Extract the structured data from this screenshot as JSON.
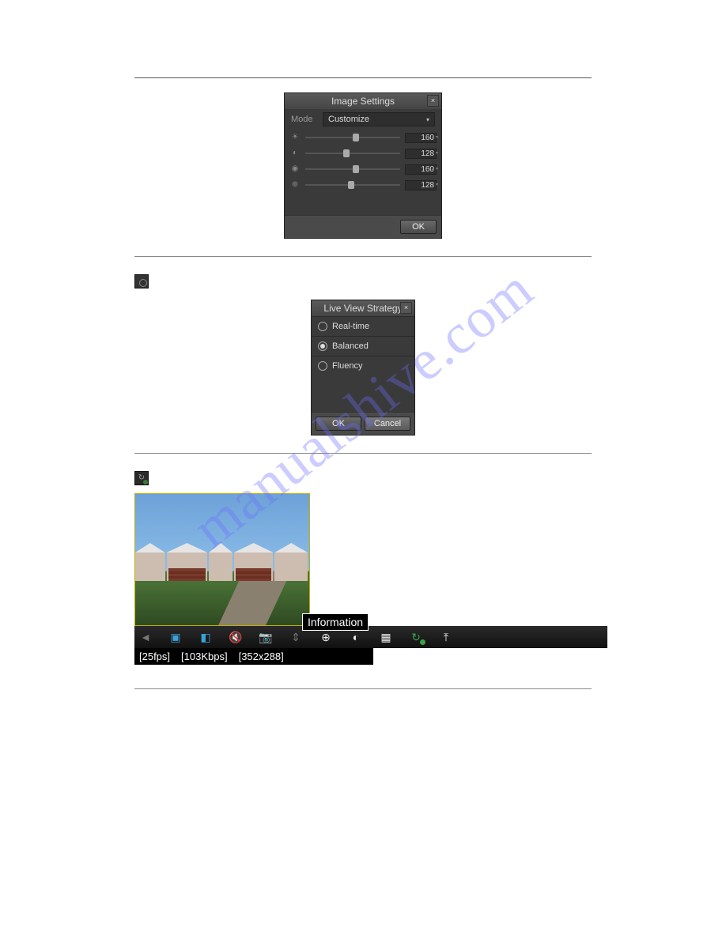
{
  "watermark": "manualshive.com",
  "image_settings": {
    "title": "Image Settings",
    "mode_label": "Mode",
    "mode_value": "Customize",
    "sliders": [
      {
        "icon": "brightness-icon",
        "glyph": "☀",
        "value": "160",
        "pos": 50
      },
      {
        "icon": "contrast-icon",
        "glyph": "◐",
        "value": "128",
        "pos": 40
      },
      {
        "icon": "saturation-icon",
        "glyph": "◉",
        "value": "160",
        "pos": 50
      },
      {
        "icon": "hue-icon",
        "glyph": "⊕",
        "value": "128",
        "pos": 45
      }
    ],
    "ok": "OK"
  },
  "live_view_strategy": {
    "title": "Live View Strategy",
    "options": [
      "Real-time",
      "Balanced",
      "Fluency"
    ],
    "selected_index": 1,
    "ok": "OK",
    "cancel": "Cancel"
  },
  "tooltip": "Information",
  "info_bar": {
    "fps": "[25fps]",
    "bitrate": "[103Kbps]",
    "resolution": "[352x288]"
  },
  "toolbar_icons": [
    {
      "name": "arrow-back-icon",
      "glyph": "◄",
      "cls": "grey"
    },
    {
      "name": "record-clip-icon",
      "glyph": "▣",
      "cls": ""
    },
    {
      "name": "playback-icon",
      "glyph": "◧",
      "cls": ""
    },
    {
      "name": "audio-mute-icon",
      "glyph": "🔇",
      "cls": "white"
    },
    {
      "name": "capture-icon",
      "glyph": "📷",
      "cls": "white"
    },
    {
      "name": "ptz-icon",
      "glyph": "⇕",
      "cls": "grey"
    },
    {
      "name": "digital-zoom-icon",
      "glyph": "⊕",
      "cls": "white"
    },
    {
      "name": "image-settings-icon",
      "glyph": "◐",
      "cls": "white"
    },
    {
      "name": "live-view-strategy-icon",
      "glyph": "▦",
      "cls": "white"
    },
    {
      "name": "information-icon",
      "glyph": "↻",
      "cls": "green"
    },
    {
      "name": "close-icon",
      "glyph": "⤒",
      "cls": "white"
    }
  ]
}
